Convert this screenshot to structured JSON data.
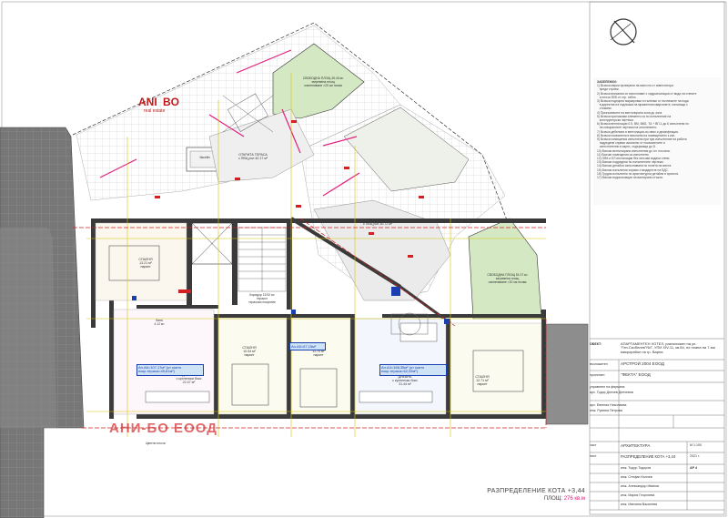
{
  "logo": {
    "brand_top": "ANI",
    "brand_top_tail": "BO",
    "brand_sub": "real estate"
  },
  "watermark": "АНИ-БО ЕООД",
  "north_symbol": "north-arrow-icon",
  "notes": {
    "title": "ЗАБЕЛЕЖКИ:",
    "lines": [
      "1) Всички мерки проверени на мястото от инвеститора",
      "   преди строеж.",
      "2) Всички влизания се изпълняват с хидроизолация от вида на стените",
      "   и плоча ЗЕВ от стр. табло.",
      "3) Всички подпорни маркировки и пълнежи от пълнежите на пода",
      "   в директна на подложка на мражнения кварталите, налагащо с",
      "   стомани.",
      "4) Прекъсвачите на вентилирана зона до зона.",
      "5) Всички приложими елементи са по изпълнение на",
      "   конструкторски чертежи.",
      "6) Всички вентилации 0.5, ВМ, ВМ2, ТА + ВП-1 до 6 изпълнени по",
      "   на специалните чертежи на отоплението.",
      "7) Всички дебелини в вентилация-по-ниво и дезинфекция.",
      "8) Всички показатели в височини на помещението к изп.",
      "9) Всички помещения изпълнени при при изпълнение на работа",
      "   подредени спрямо аксиално от показателите и",
      "   изпълнителни в карти, съдържащи до 8.",
      "10) Всички вентилирани изпълнения до пл. плочата.",
      "11) Всички помещения са изпълнени.",
      "12) ОВК и ЕЛ инсталации без гипсови водачи стени.",
      "13) Всички подредени по изпълнените чертежи.",
      "14) Всички детайли изпълнявани по полети на места.",
      "15) Всички изпълнени спрямо стандартите на БДС.",
      "16) Трудна изпълнени по архитектурни детайли в проекта.",
      "17) Всички водоизолации на вантирани стъкла."
    ]
  },
  "rooms": {
    "garden_top": "СВОБОДНА ПЛОЩ 45.43 м²\nзатревена площ\nозеленяване >20 см почва",
    "garden_right": "СВОБОДНА ПЛОЩ 51.07 м²\nзатревена площ\nозеленяване >20 см почва",
    "terrace_left": "ОТКРИТА ТЕРАСА\nс ПВЦ рол 42.17 м²",
    "terrace_right": "ОТКРИТА ТЕРАСА\nс ПВЦ рол 30.72 м²",
    "pool": "басейн",
    "lobby": "Коридор 15.92 м²\nтеракот\nтерасово покритие",
    "bedroom_left": "СПАЛНЯ\n13.21 м²\nпаркет",
    "bedroom_right": "СПАЛНЯ\n12.71 м²\nпаркет",
    "living_left": "ДНЕВНА\nс кухненски бокс\n22.47 м²",
    "bedroom_mid1": "СПАЛНЯ\n10.54 м²\nпаркет",
    "bedroom_mid2": "СПАЛНЯ\n11.70 м²\nпаркет",
    "living_right": "ДНЕВНА\nс кухненски бокс\n31.44 м²",
    "bath": "баня\n4.12 м²",
    "apt_a6_tag": "Ап.А6=107,17м² (от които покр.тераса=45,61м²)",
    "apt_a5_tag": "Ап.А5=57,15м²",
    "apt_a4_tag": "Ап.А4=168,35м² (от които покр.тераса=62,05м²)",
    "street_label": "Цветни плочи"
  },
  "title_block": {
    "object_label": "ОБЕКТ:",
    "object_value": "АПАРТАМЕНТЕН ХОТЕЛ, разположен на ул. \"Ген.Скобелев\"№7, УПИ XIV-11, кв.84, по плана на 7-ми микрорайон на гр. Варна",
    "contractor_label": "възложител",
    "contractor_value": "АРСТРОЙ 2004 ЕООД",
    "designer_label": "проектант",
    "designer_value": "\"ФЕКТА\" ЕООД",
    "manager_label": "управител на фирмата:",
    "manager_value": "арх. Тодор Делчев Делчевов",
    "part_label": "част",
    "part_value": "АРХИТЕКТУРА",
    "sheet_label": "лист",
    "sheet_value": "РАЗПРЕДЕЛЕНИЕ КОТА +3,44",
    "scale_label": "М 1:100",
    "date_label": "2021 г.",
    "sheet_no": "АР 4",
    "names": [
      "арх. Евгения Николаева",
      "инж. Румяна Петрова",
      "инж. Тодор Тодоров",
      "инж. Стефан Кънчев",
      "инж. Александър Иванов",
      "инж. Мария Георгиева",
      "инж. Ивелина Василева"
    ]
  },
  "caption": {
    "title": "РАЗПРЕДЕЛЕНИЕ КОТА +3,44",
    "area_label": "ПЛОЩ:",
    "area_value": "276 кв.м"
  },
  "colors": {
    "wall": "#3a3a3a",
    "neighbor": "#7a7a7a",
    "garden": "#d4e8c4",
    "terrace": "#e6e6e6",
    "magenta": "#e0207e",
    "red": "#d22020",
    "blue": "#1a3fb0",
    "tag_fill": "#cfe3f7"
  }
}
